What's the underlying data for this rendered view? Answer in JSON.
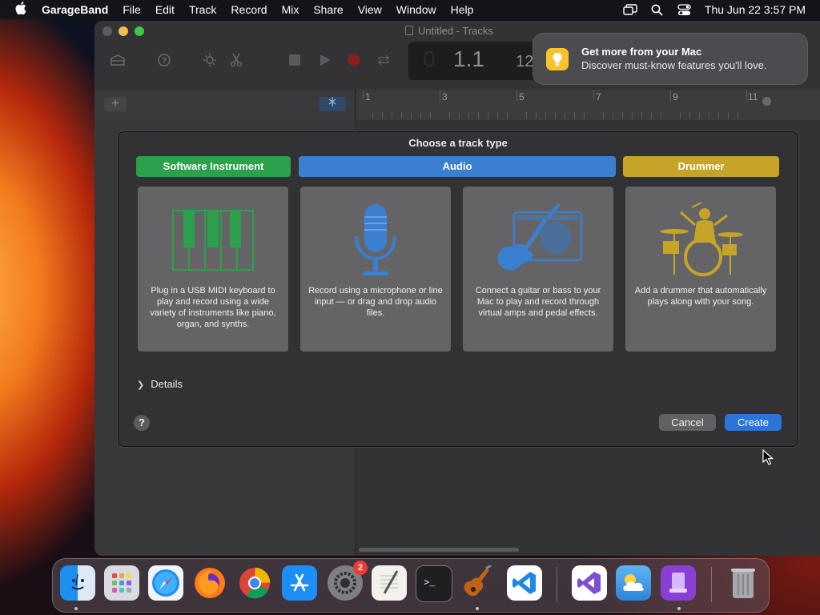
{
  "menubar": {
    "app_name": "GarageBand",
    "items": [
      "File",
      "Edit",
      "Track",
      "Record",
      "Mix",
      "Share",
      "View",
      "Window",
      "Help"
    ],
    "datetime": "Thu Jun 22  3:57 PM"
  },
  "window": {
    "title": "Untitled - Tracks",
    "lcd": {
      "position": "1.1",
      "tempo_fragment": "12"
    },
    "ruler_marks": [
      "1",
      "3",
      "5",
      "7",
      "9",
      "11"
    ]
  },
  "notification": {
    "title": "Get more from your Mac",
    "body": "Discover must-know features you'll love."
  },
  "dialog": {
    "title": "Choose a track type",
    "tabs": [
      {
        "label": "Software Instrument",
        "color": "#2aa14a"
      },
      {
        "label": "Audio",
        "color": "#3b7fd0"
      },
      {
        "label": "Drummer",
        "color": "#c6a42a"
      }
    ],
    "cards": [
      {
        "desc": "Plug in a USB MIDI keyboard to play and record using a wide variety of instruments like piano, organ, and synths."
      },
      {
        "desc": "Record using a microphone or line input — or drag and drop audio files."
      },
      {
        "desc": "Connect a guitar or bass to your Mac to play and record through virtual amps and pedal effects."
      },
      {
        "desc": "Add a drummer that automatically plays along with your song."
      }
    ],
    "details_label": "Details",
    "help_label": "?",
    "cancel_label": "Cancel",
    "create_label": "Create"
  },
  "dock": {
    "badge_count": "2"
  },
  "colors": {
    "accent": "#2b74d8",
    "green": "#2aa14a",
    "blue": "#3b7fd0",
    "gold": "#c6a42a"
  }
}
